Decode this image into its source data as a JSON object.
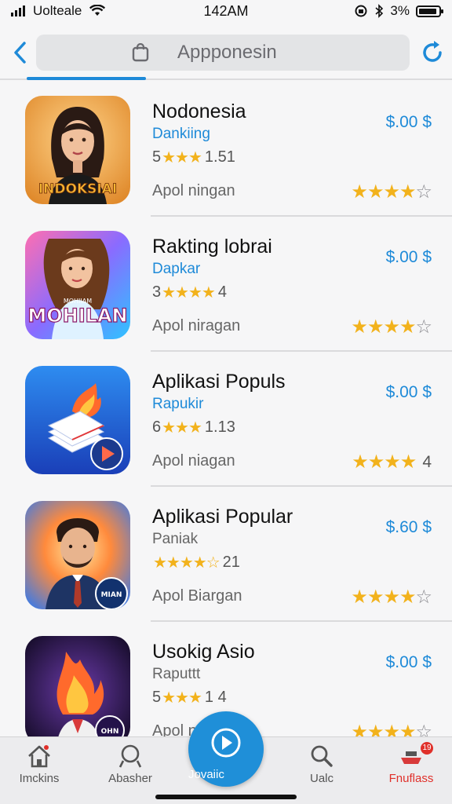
{
  "status_bar": {
    "carrier": "Uolteale",
    "time": "142AM",
    "battery_percent": "3%",
    "battery_level": 0.9
  },
  "nav": {
    "search_text": "Appponesin"
  },
  "apps": [
    {
      "name": "Nodonesia",
      "subtitle": "Dankiing",
      "subtitle_color": "#1e8ad8",
      "meta_prefix": "5",
      "meta_stars": "★★★",
      "meta_suffix": "1.51",
      "description": "Apol ningan",
      "price": "$.00 $",
      "rating_full": "★★★★",
      "rating_empty": "☆",
      "rating_num": "",
      "icon_label": "INDOKSIAI"
    },
    {
      "name": "Rakting lobrai",
      "subtitle": "Dapkar",
      "subtitle_color": "#1e8ad8",
      "meta_prefix": "3",
      "meta_stars": "★★★★",
      "meta_suffix": "4",
      "description": "Apol niragan",
      "price": "$.00 $",
      "rating_full": "★★★★",
      "rating_empty": "☆",
      "rating_num": "",
      "icon_label": "MOHILAN",
      "icon_small_label": "MOHIIAM"
    },
    {
      "name": "Aplikasi Populs",
      "subtitle": "Rapukir",
      "subtitle_color": "#1e8ad8",
      "meta_prefix": "6",
      "meta_stars": "★★★",
      "meta_suffix": "1.13",
      "description": "Apol niagan",
      "price": "$.00 $",
      "rating_full": "★★★★",
      "rating_empty": "",
      "rating_num": "4",
      "icon_label": ""
    },
    {
      "name": "Aplikasi Popular",
      "subtitle": "Paniak",
      "subtitle_color": "#666666",
      "meta_prefix": "",
      "meta_stars": "★★★★☆",
      "meta_suffix": "21",
      "description": "Apol Biargan",
      "price": "$.60 $",
      "rating_full": "★★★★",
      "rating_empty": "☆",
      "rating_num": "",
      "icon_label": "MIAN"
    },
    {
      "name": "Usokig Asio",
      "subtitle": "Raputtt",
      "subtitle_color": "#666666",
      "meta_prefix": "5",
      "meta_stars": "★★★",
      "meta_suffix": "1 4",
      "description": "Apol ni",
      "price": "$.00 $",
      "rating_full": "★★★★",
      "rating_empty": "☆",
      "rating_num": "",
      "icon_label": "OHN"
    }
  ],
  "tabs": [
    {
      "label": "Imckins",
      "icon": "home-icon"
    },
    {
      "label": "Abasher",
      "icon": "search-person-icon"
    },
    {
      "label": "Jovaiic",
      "icon": "play-icon"
    },
    {
      "label": "Ualc",
      "icon": "search-icon"
    },
    {
      "label": "Fnuflass",
      "icon": "tray-icon",
      "badge": "19"
    }
  ],
  "colors": {
    "accent": "#1e8ad8",
    "star": "#f2b21c",
    "active_tab_label": "#e0302a"
  }
}
